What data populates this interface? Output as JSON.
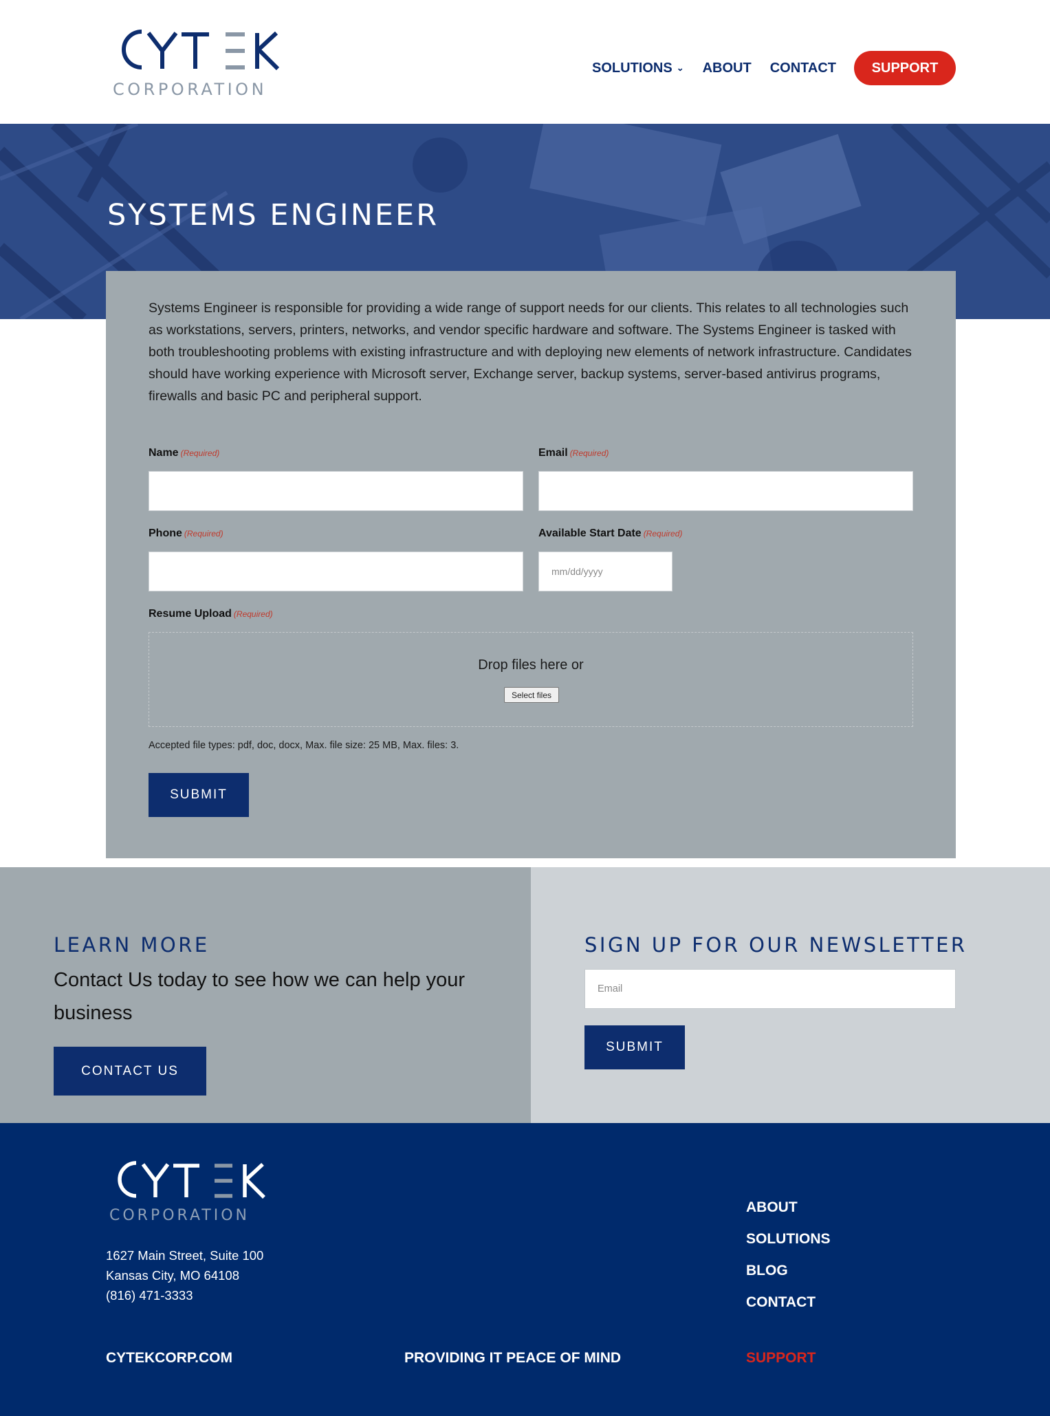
{
  "header": {
    "logo": {
      "wordmark": "CYTEK",
      "subtitle": "CORPORATION"
    },
    "nav": [
      {
        "label": "SOLUTIONS"
      },
      {
        "label": "ABOUT"
      },
      {
        "label": "CONTACT"
      }
    ],
    "support_label": "SUPPORT"
  },
  "hero": {
    "title": "SYSTEMS ENGINEER"
  },
  "job": {
    "description": "Systems Engineer is responsible for providing a wide range of support needs for our clients. This relates to all technologies such as workstations, servers, printers, networks, and vendor specific hardware and software. The Systems Engineer is tasked with both troubleshooting problems with existing infrastructure and with deploying new elements of network infrastructure. Candidates should have working experience with Microsoft server, Exchange server, backup systems, server-based antivirus programs, firewalls and basic PC and peripheral support."
  },
  "form": {
    "required_text": "(Required)",
    "name_label": "Name",
    "email_label": "Email",
    "phone_label": "Phone",
    "start_date_label": "Available Start Date",
    "start_date_placeholder": "mm/dd/yyyy",
    "resume_label": "Resume Upload",
    "drop_text": "Drop files here or",
    "select_files": "Select files",
    "file_note": "Accepted file types: pdf, doc, docx, Max. file size: 25 MB, Max. files: 3.",
    "submit": "SUBMIT"
  },
  "learn_more": {
    "heading": "LEARN MORE",
    "text": "Contact Us today to see how we can help your business",
    "button": "CONTACT US"
  },
  "newsletter": {
    "heading": "SIGN UP FOR OUR NEWSLETTER",
    "email_placeholder": "Email",
    "submit": "SUBMIT"
  },
  "footer": {
    "logo": {
      "wordmark": "CYTEK",
      "subtitle": "CORPORATION"
    },
    "address_line1": "1627 Main Street, Suite 100",
    "address_line2": "Kansas City, MO 64108",
    "phone": "(816) 471-3333",
    "links": [
      {
        "label": "ABOUT"
      },
      {
        "label": "SOLUTIONS"
      },
      {
        "label": "BLOG"
      },
      {
        "label": "CONTACT"
      }
    ],
    "site": "CYTEKCORP.COM",
    "tagline": "PROVIDING IT PEACE OF MIND",
    "support": "SUPPORT"
  },
  "colors": {
    "brand_navy": "#0d2d6e",
    "footer_navy": "#002a6c",
    "support_red": "#d9261c",
    "card_gray": "#a0a9ae",
    "newsletter_gray": "#cdd2d6",
    "logo_gray": "#8a97a6"
  }
}
